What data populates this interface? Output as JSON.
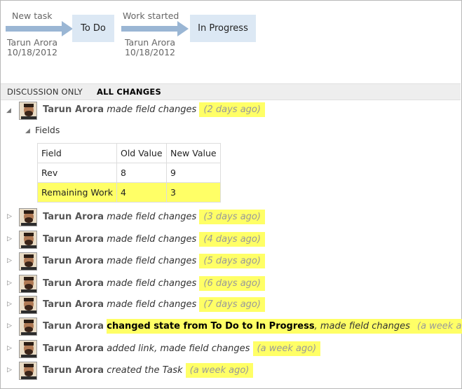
{
  "workflow": {
    "step1": {
      "reason": "New task",
      "by": "Tarun Arora",
      "date": "10/18/2012",
      "state": "To Do"
    },
    "step2": {
      "reason": "Work started",
      "by": "Tarun Arora",
      "date": "10/18/2012",
      "state": "In Progress"
    }
  },
  "tabs": {
    "discussion_only": "DISCUSSION ONLY",
    "all_changes": "ALL CHANGES"
  },
  "expanded_entry": {
    "author": "Tarun Arora",
    "action": "made field changes",
    "time": "(2 days ago)",
    "fields_label": "Fields",
    "columns": [
      "Field",
      "Old Value",
      "New Value"
    ],
    "rows": [
      [
        "Rev",
        "8",
        "9"
      ],
      [
        "Remaining Work",
        "4",
        "3"
      ]
    ]
  },
  "entries": [
    {
      "author": "Tarun Arora",
      "action": "made field changes",
      "time": "(3 days ago)"
    },
    {
      "author": "Tarun Arora",
      "action": "made field changes",
      "time": "(4 days ago)"
    },
    {
      "author": "Tarun Arora",
      "action": "made field changes",
      "time": "(5 days ago)"
    },
    {
      "author": "Tarun Arora",
      "action": "made field changes",
      "time": "(6 days ago)"
    },
    {
      "author": "Tarun Arora",
      "action": "made field changes",
      "time": "(7 days ago)"
    },
    {
      "author": "Tarun Arora",
      "action_bold": "changed state from To Do to In Progress",
      "action": ", made field changes",
      "time": "(a week ago)"
    },
    {
      "author": "Tarun Arora",
      "action": "added link, made field changes",
      "time": "(a week ago)"
    },
    {
      "author": "Tarun Arora",
      "action": "created the Task",
      "time": "(a week ago)"
    }
  ],
  "colors": {
    "highlight": "#ffff66",
    "state_box": "#dce8f4",
    "arrow": "#9ab6d4"
  },
  "icons": {
    "expanded": "triangle-down-icon",
    "collapsed": "triangle-right-icon"
  }
}
